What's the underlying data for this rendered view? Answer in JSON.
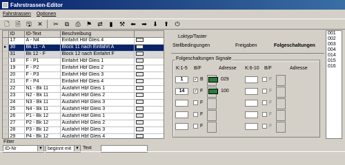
{
  "window": {
    "title": "Fahrstrassen-Editor"
  },
  "menu": [
    "Fahrstrassen",
    "Optionen"
  ],
  "toolbar": [
    "new-icon",
    "open-icon",
    "save-icon",
    "delete-icon",
    "cut-icon",
    "copy-icon",
    "print-icon",
    "signal-icon",
    "route-icon",
    "bar-icon",
    "tool-icon",
    "arrow-left-icon",
    "arrow-right-icon",
    "arrow-down-icon",
    "arrow-up-icon",
    "exit-icon"
  ],
  "table": {
    "headers": [
      "ID",
      "ID-Text",
      "Beschreibung",
      ""
    ],
    "rows": [
      {
        "id": "17",
        "text": "A - N4",
        "desc": "Einfahrt Hbf Gleis 4"
      },
      {
        "id": "30",
        "text": "Bk 11 - A",
        "desc": "Block 11 nach Einfahrt A"
      },
      {
        "id": "31",
        "text": "Bk 12 - F",
        "desc": "Block 12 nach Einfahrt F"
      },
      {
        "id": "18",
        "text": "F - P1",
        "desc": "Einfahrt Hbf Gleis 1"
      },
      {
        "id": "19",
        "text": "F - P2",
        "desc": "Einfahrt Hbf Gleis 2"
      },
      {
        "id": "20",
        "text": "F - P3",
        "desc": "Einfahrt Hbf Gleis 3"
      },
      {
        "id": "21",
        "text": "F - P4",
        "desc": "Einfahrt Hbf Gleis 4"
      },
      {
        "id": "22",
        "text": "N1 - Bk 11",
        "desc": "Ausfahrt Hbf Gleis 1"
      },
      {
        "id": "23",
        "text": "N2 - Bk 11",
        "desc": "Ausfahrt Hbf Gleis 2"
      },
      {
        "id": "24",
        "text": "N3 - Bk 11",
        "desc": "Ausfahrt Hbf Gleis 3"
      },
      {
        "id": "25",
        "text": "N4 - Bk 11",
        "desc": "Ausfahrt Hbf Gleis 3"
      },
      {
        "id": "26",
        "text": "P1 - Bk 12",
        "desc": "Ausfahrt Hbf Gleis 1"
      },
      {
        "id": "27",
        "text": "P2 - Bk 12",
        "desc": "Ausfahrt Hbf Gleis 2"
      },
      {
        "id": "28",
        "text": "P3 - Bk 12",
        "desc": "Ausfahrt Hbf Gleis 3"
      },
      {
        "id": "29",
        "text": "P4 - Bk 12",
        "desc": "Ausfahrt Hbf Gleis 4"
      }
    ]
  },
  "filter": {
    "label": "Filter",
    "field": "ID-Nr",
    "mode": "beginnt mit",
    "text_label": "Text",
    "text_value": ""
  },
  "tabs": {
    "loklyp": "Loktyp/Taster",
    "stell": "Stellbedingungen",
    "freigaben": "Freigaben",
    "folge": "Folgeschaltungen"
  },
  "group": {
    "title": "Folgeschaltungen Signale",
    "col_k15": "K:1-5",
    "col_bf": "B/F",
    "col_adr": "Adresse",
    "col_k610": "K:6-10",
    "col_bf2": "B/F",
    "col_adr2": "Adresse",
    "row1": {
      "k": "1",
      "bf": "B",
      "adr": "029"
    },
    "row2": {
      "k": "14",
      "bf": "F",
      "adr": "100"
    },
    "check_off": "F"
  },
  "list": [
    "001",
    "002",
    "003",
    "004",
    "014",
    "015",
    "016"
  ]
}
